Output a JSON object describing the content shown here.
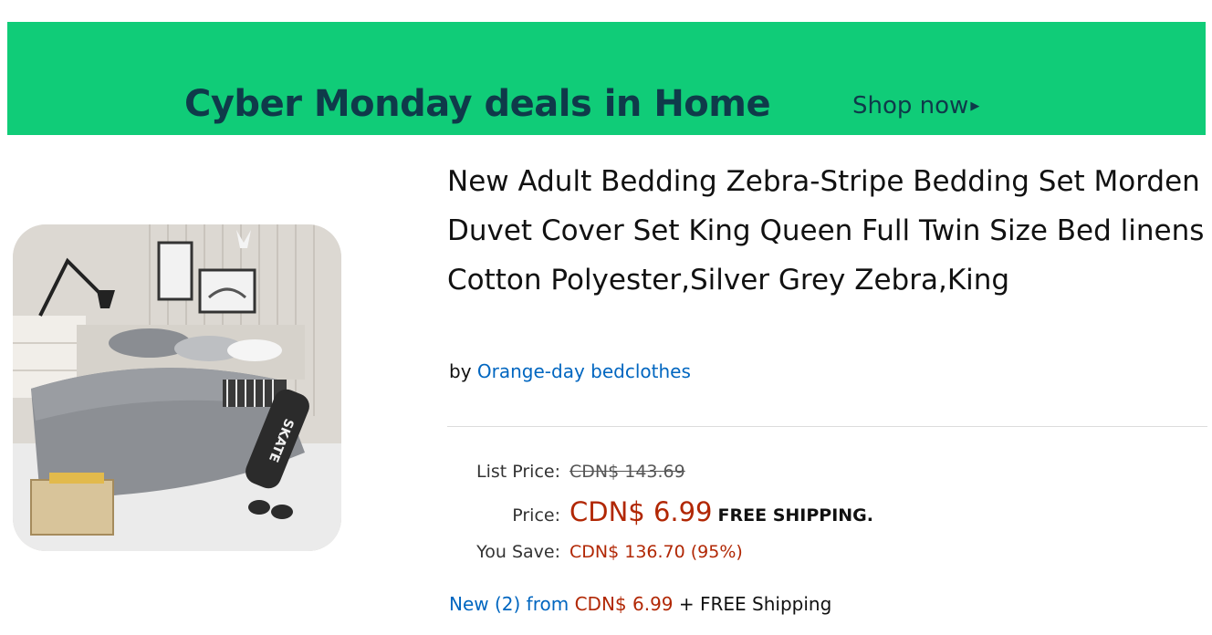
{
  "banner": {
    "title": "Cyber Monday deals in Home",
    "cta": "Shop now",
    "cta_icon": "triangle-right-icon",
    "background_color": "#10cc78",
    "text_color": "#0f3a4a"
  },
  "product": {
    "image_alt": "SKATE",
    "title": "New Adult Bedding Zebra-Stripe Bedding Set Morden Duvet Cover Set King Queen Full Twin Size Bed linens Cotton Polyester,Silver Grey Zebra,King",
    "by_prefix": "by",
    "brand": "Orange-day bedclothes"
  },
  "pricing": {
    "list_label": "List Price:",
    "list_value": "CDN$ 143.69",
    "price_label": "Price:",
    "price_value": "CDN$ 6.99",
    "shipping": "FREE SHIPPING.",
    "save_label": "You Save:",
    "save_value": "CDN$ 136.70 (95%)",
    "price_color": "#b12704"
  },
  "offers": {
    "link_text": "New (2) from",
    "price": "CDN$ 6.99",
    "suffix": "+ FREE Shipping"
  },
  "colors": {
    "link": "#0066c0"
  }
}
